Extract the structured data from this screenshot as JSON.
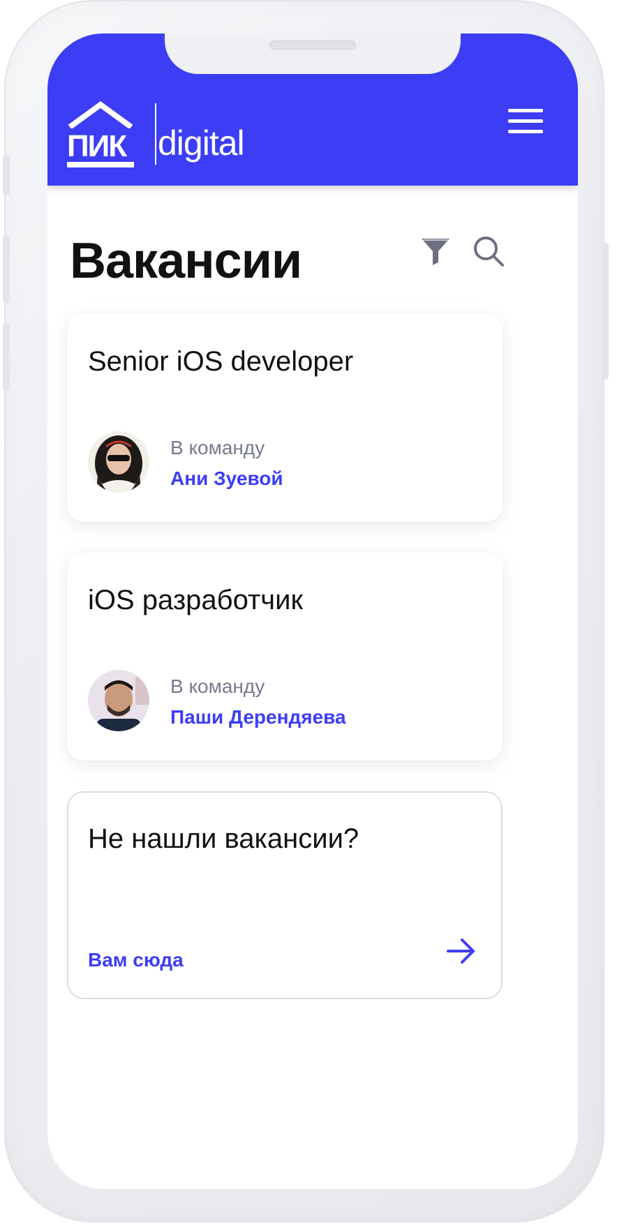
{
  "header": {
    "logo_text": "ПИК",
    "logo_suffix": "digital",
    "menu_icon": "hamburger-menu-icon",
    "background_color": "#3d3df5"
  },
  "page": {
    "title": "Вакансии",
    "filter_icon": "filter-icon",
    "search_icon": "search-icon"
  },
  "vacancies": [
    {
      "title": "Senior iOS developer",
      "team_label": "В команду",
      "team_lead": "Ани Зуевой"
    },
    {
      "title": "iOS разработчик",
      "team_label": "В команду",
      "team_lead": "Паши Дерендяева"
    }
  ],
  "cta": {
    "title": "Не нашли вакансии?",
    "link_label": "Вам сюда",
    "arrow_icon": "arrow-right-icon"
  },
  "colors": {
    "accent": "#3d3df5",
    "muted_text": "#777b8c",
    "primary_text": "#111111"
  }
}
